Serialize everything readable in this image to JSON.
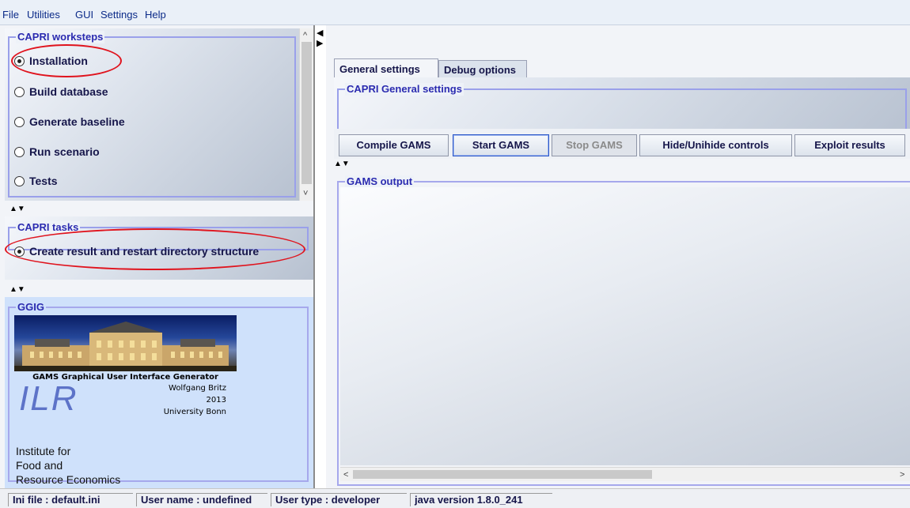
{
  "menu": [
    "File",
    "Utilities",
    "GUI",
    "Settings",
    "Help"
  ],
  "worksteps": {
    "legend": "CAPRI worksteps",
    "items": [
      {
        "label": "Installation",
        "checked": true
      },
      {
        "label": "Build database",
        "checked": false
      },
      {
        "label": "Generate baseline",
        "checked": false
      },
      {
        "label": "Run scenario",
        "checked": false
      },
      {
        "label": "Tests",
        "checked": false
      }
    ]
  },
  "tasks": {
    "legend": "CAPRI tasks",
    "items": [
      {
        "label": "Create result and restart directory structure",
        "checked": true
      }
    ]
  },
  "ggig": {
    "legend": "GGIG",
    "banner_title": "GAMS Graphical User Interface Generator",
    "author": "Wolfgang Britz",
    "year": "2013",
    "university": "University Bonn",
    "logo_text": "ILR",
    "institute_lines": [
      "Institute  for",
      "Food and",
      "Resource Economics"
    ]
  },
  "tabs": [
    {
      "label": "General settings",
      "active": true
    },
    {
      "label": "Debug options",
      "active": false
    }
  ],
  "general_settings": {
    "legend": "CAPRI General settings"
  },
  "toolbar": {
    "compile": "Compile GAMS",
    "start": "Start GAMS",
    "stop": "Stop GAMS",
    "hide": "Hide/Unihide controls",
    "exploit": "Exploit results"
  },
  "output": {
    "legend": "GAMS output"
  },
  "status": {
    "ini": "Ini file : default.ini",
    "user_name": "User name : undefined",
    "user_type": "User type : developer",
    "java": "java version 1.8.0_241"
  },
  "colors": {
    "highlight": "#e0141e",
    "legend": "#2b2bb0",
    "menu": "#0b2a88"
  }
}
